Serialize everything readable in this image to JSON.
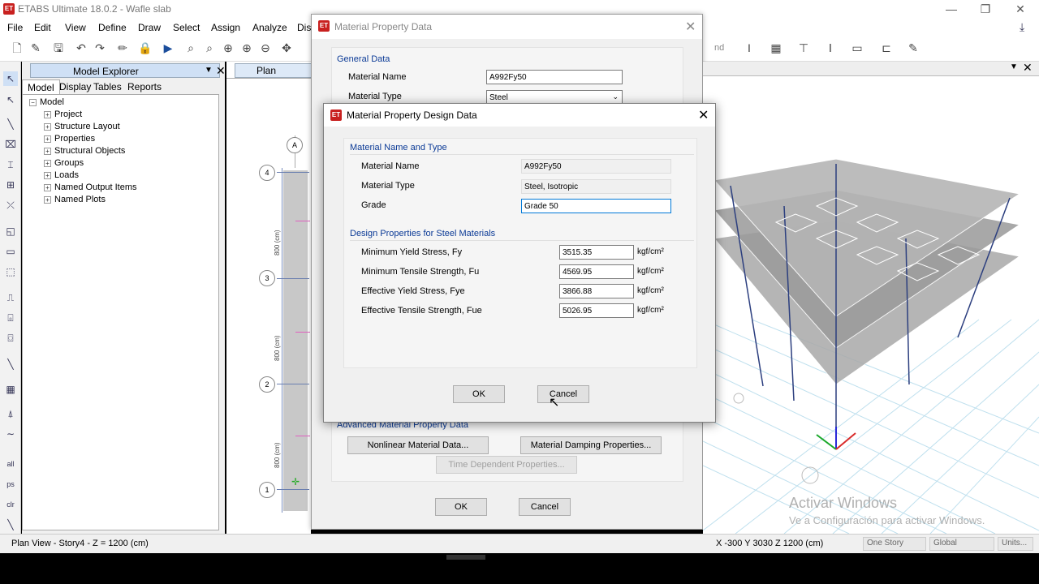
{
  "app": {
    "title": "ETABS Ultimate 18.0.2 - Wafle slab",
    "logo": "ET"
  },
  "menu": [
    "File",
    "Edit",
    "View",
    "Define",
    "Draw",
    "Select",
    "Assign",
    "Analyze",
    "Dis"
  ],
  "toolbar_right": {
    "nd": "nd"
  },
  "explorer": {
    "title": "Model Explorer",
    "tabs": [
      "Model",
      "Display",
      "Tables",
      "Reports"
    ],
    "root": "Model",
    "items": [
      "Project",
      "Structure Layout",
      "Properties",
      "Structural Objects",
      "Groups",
      "Loads",
      "Named Output Items",
      "Named Plots"
    ]
  },
  "plan": {
    "tab": "Plan View - St",
    "axis_a": "A",
    "bubbles": [
      "4",
      "3",
      "2",
      "1"
    ],
    "dims": [
      "800 (cm)",
      "800 (cm)",
      "800 (cm)"
    ]
  },
  "bg_dialog": {
    "title": "Material Property Data",
    "general_group": "General Data",
    "name_label": "Material Name",
    "name_value": "A992Fy50",
    "type_label": "Material Type",
    "type_value": "Steel",
    "advanced_group": "Advanced Material Property Data",
    "nonlinear_btn": "Nonlinear Material Data...",
    "damping_btn": "Material Damping Properties...",
    "time_btn": "Time Dependent Properties...",
    "ok": "OK",
    "cancel": "Cancel"
  },
  "fg_dialog": {
    "title": "Material Property Design Data",
    "group1": "Material Name and Type",
    "name_label": "Material Name",
    "name_value": "A992Fy50",
    "type_label": "Material Type",
    "type_value": "Steel, Isotropic",
    "grade_label": "Grade",
    "grade_value": "Grade 50",
    "group2": "Design Properties for Steel Materials",
    "props": [
      {
        "label": "Minimum Yield Stress, Fy",
        "value": "3515.35",
        "unit": "kgf/cm²"
      },
      {
        "label": "Minimum Tensile Strength, Fu",
        "value": "4569.95",
        "unit": "kgf/cm²"
      },
      {
        "label": "Effective Yield Stress, Fye",
        "value": "3866.88",
        "unit": "kgf/cm²"
      },
      {
        "label": "Effective Tensile Strength, Fue",
        "value": "5026.95",
        "unit": "kgf/cm²"
      }
    ],
    "ok": "OK",
    "cancel": "Cancel"
  },
  "watermark": {
    "line1": "Activar Windows",
    "line2": "Ve a Configuración para activar Windows."
  },
  "status": {
    "left": "Plan View - Story4 - Z = 1200 (cm)",
    "coords": "X -300  Y 3030  Z 1200 (cm)",
    "story": "One Story",
    "system": "Global",
    "units": "Units..."
  }
}
